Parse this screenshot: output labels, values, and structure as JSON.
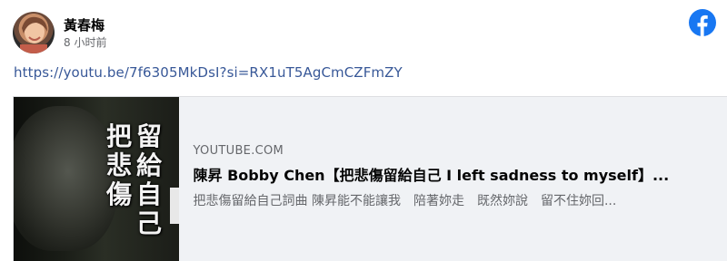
{
  "post": {
    "author": "黃春梅",
    "time": "8 小时前",
    "link": "https://youtu.be/7f6305MkDsI?si=RX1uT5AgCmCZFmZY"
  },
  "card": {
    "domain": "YOUTUBE.COM",
    "title": "陳昇 Bobby Chen【把悲傷留給自己 I left sadness to myself】...",
    "description": "把悲傷留給自己詞曲 陳昇能不能讓我　陪著妳走　既然妳說　留不住妳回...",
    "thumbnail": {
      "right_column": "留給自己",
      "left_column": "把悲傷"
    }
  },
  "colors": {
    "facebook_blue": "#1877f2",
    "link_blue": "#385898",
    "secondary_text": "#65676b",
    "card_bg": "#f0f2f5"
  },
  "icons": [
    "avatar",
    "facebook-logo-icon"
  ]
}
